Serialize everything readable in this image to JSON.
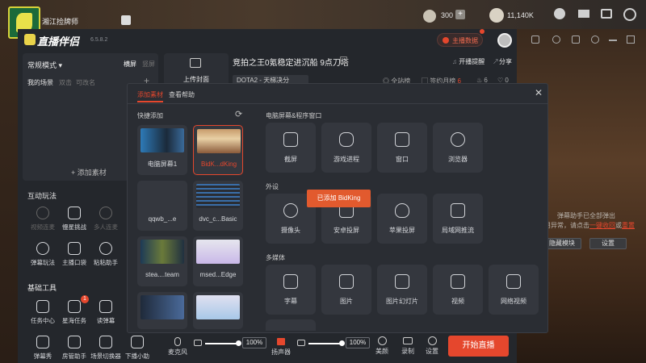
{
  "top": {
    "username": "湘江捡牌师",
    "coins": "300",
    "gold": "11,140K"
  },
  "app": {
    "title": "直播伴侣",
    "version": "6.5.8.2",
    "host_data_button": "主播数据",
    "stream_title": "竞拍之王0氪稳定进沉船 9点刀塔",
    "category": "DOTA2 - 天梯决分",
    "open_reminder": "开播提醒",
    "share": "分享",
    "full_station": "全站榜",
    "sign_month": "签约月榜",
    "sign_rank": "6",
    "hot": "6",
    "likes": "0",
    "upload_cover": "上传封面"
  },
  "scenes": {
    "mode_label": "常规模式",
    "landscape": "横屏",
    "portrait": "竖屏",
    "my_scenes": "我的场景",
    "double_click": "双击",
    "rename": "可改名",
    "add_material": "+ 添加素材"
  },
  "interactive": {
    "title": "互动玩法",
    "items": [
      "视频连麦",
      "慢星挑战",
      "多人连麦",
      "弹幕玩法",
      "主播口袋",
      "粘粘助手"
    ]
  },
  "basic_tools": {
    "title": "基础工具",
    "items": [
      "任务中心",
      "星海任务",
      "读弹幕",
      "弹幕秀",
      "房管助手",
      "场景切换器",
      "下播小助"
    ],
    "badge": "1"
  },
  "modal": {
    "tab_add": "添加素材",
    "tab_help": "查看帮助",
    "quick_add": "快捷添加",
    "quick_items": [
      "电脑屏幕1",
      "BidK...dKing",
      "qqwb_...e",
      "dvc_c...Basic",
      "stea....team",
      "msed...Edge"
    ],
    "screen_section": "电脑屏幕&程序窗口",
    "screen_items": [
      "截屏",
      "游戏进程",
      "窗口",
      "浏览器"
    ],
    "external_section": "外设",
    "external_items": [
      "摄像头",
      "安卓投屏",
      "苹果投屏",
      "局域网推流"
    ],
    "media_section": "多媒体",
    "media_items": [
      "字幕",
      "图片",
      "图片幻灯片",
      "视频",
      "网络视频"
    ],
    "toast": "已添加 BidKing"
  },
  "bottom": {
    "mic": "麦克风",
    "mic_pct": "100%",
    "speaker": "扬声器",
    "speaker_pct": "100%",
    "beauty": "美颜",
    "record": "录制",
    "settings": "设置",
    "start_stream": "开始直播"
  },
  "right_panel": {
    "line1": "弹幕助手已全部弹出",
    "line2_prefix": "如用异常，请点击",
    "link1": "一键收回",
    "and": "或",
    "link2": "重置",
    "hide_button": "隐藏模块",
    "settings_button": "设置"
  },
  "colors": {
    "accent": "#e5472d",
    "toast": "#e25a2e",
    "dialog_bg": "#2a2d33"
  }
}
